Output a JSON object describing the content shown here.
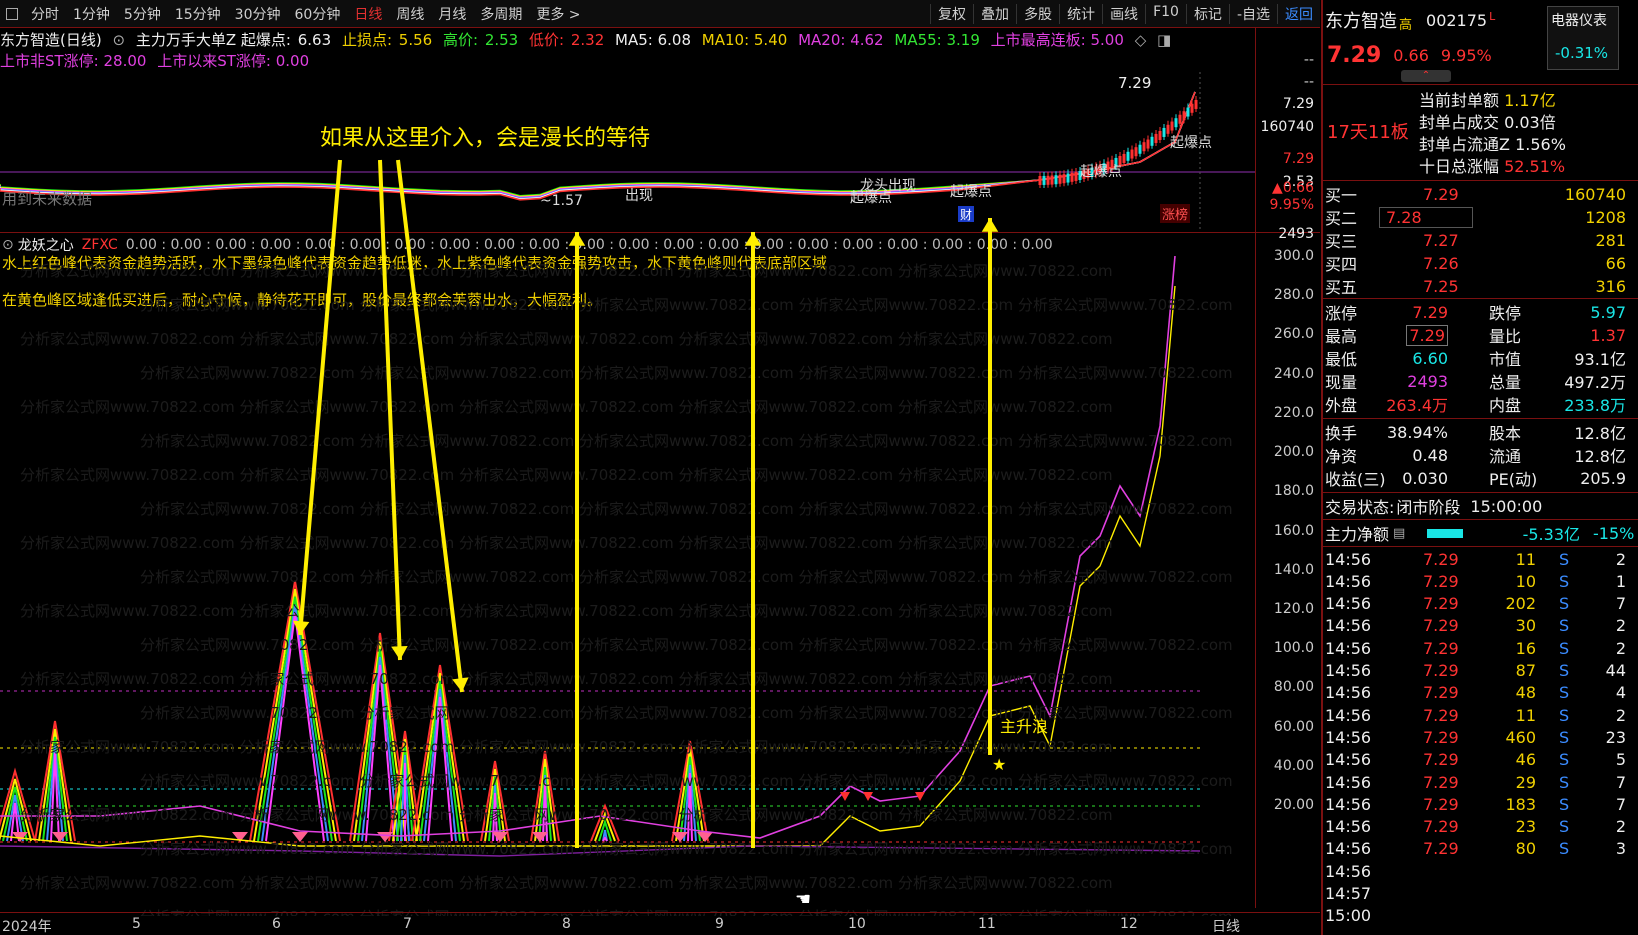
{
  "toolbar": {
    "periods": [
      "分时",
      "1分钟",
      "5分钟",
      "15分钟",
      "30分钟",
      "60分钟",
      "日线",
      "周线",
      "月线",
      "多周期",
      "更多 >"
    ],
    "active_period": "日线",
    "tools": [
      "复权",
      "叠加",
      "多股",
      "统计",
      "画线",
      "F10",
      "标记",
      "-自选",
      "返回"
    ]
  },
  "header": {
    "title": "东方智造(日线)",
    "indicator": "主力万手大单Z 起爆点:",
    "qibao": "6.63",
    "stoploss_label": "止损点:",
    "stoploss": "5.56",
    "high_label": "高价:",
    "high": "2.53",
    "low_label": "低价:",
    "low": "2.32",
    "ma5": "MA5: 6.08",
    "ma10": "MA10: 5.40",
    "ma20": "MA20: 4.62",
    "ma55": "MA55: 3.19",
    "max_board": "上市最高连板: 5.00",
    "line2_a": "上市非ST涨停: 28.00",
    "line2_b": "上市以来ST涨停: 0.00"
  },
  "main_chart": {
    "future_note": "用到未来数据",
    "labels": [
      "~1.57",
      "出现",
      "龙头出现",
      "起爆点",
      "起爆点",
      "起爆点",
      "起爆点"
    ],
    "price_top": "7.29",
    "cai": "财"
  },
  "annotation": "如果从这里介入，会是漫长的等待",
  "indicator_line": {
    "name": "龙妖之心",
    "code": "ZFXC",
    "values": "0.00 : 0.00 : 0.00 : 0.00 : 0.00 : 0.00 : 0.00 : 0.00 : 0.00 : 0.00 : 0.00 : 0.00 : 0.00 : 0.00 : 0.00 : 0.00 : 0.00 : 0.00 : 0.00 : 0.00 : 0.00"
  },
  "explain": {
    "line1": "水上红色峰代表资金趋势活跃，水下墨绿色峰代表资金趋势低迷，水上紫色峰代表资金强势攻击，水下黄色峰则代表底部区域",
    "line2": "在黄色峰区域逢低买进后，耐心守候，静待花开即可，股价最终都会芙蓉出水，大幅盈利。"
  },
  "lower_chart": {
    "label_wave": "主升浪"
  },
  "right_axis": {
    "top_labels": [
      "--",
      "--",
      "7.29",
      "160740",
      "7.29",
      "2.53",
      "▲0.66",
      "9.95%",
      "涨榜"
    ],
    "lower_label": "2493",
    "ticks": [
      "300.0",
      "280.0",
      "260.0",
      "240.0",
      "220.0",
      "200.0",
      "180.0",
      "160.0",
      "140.0",
      "120.0",
      "100.0",
      "80.00",
      "60.00",
      "40.00",
      "20.00"
    ]
  },
  "bottom_axis": {
    "labels": [
      "2024年",
      "5",
      "6",
      "7",
      "8",
      "9",
      "10",
      "11",
      "12"
    ],
    "period": "日线"
  },
  "quote": {
    "name": "东方智造",
    "mark": "高",
    "code": "002175",
    "L": "L",
    "sector": "电器仪表",
    "sector_pct": "-0.31%",
    "price": "7.29",
    "change": "0.66",
    "pct": "9.95%",
    "boards": "17天11板",
    "seal_label": "当前封单额",
    "seal_value": "1.17亿",
    "seal_turn_label": "封单占成交",
    "seal_turn": "0.03倍",
    "seal_float_label": "封单占流通Z",
    "seal_float": "1.56%",
    "ten_day_label": "十日总涨幅",
    "ten_day": "52.51%",
    "bids": [
      {
        "label": "买一",
        "price": "7.29",
        "vol": "160740"
      },
      {
        "label": "买二",
        "price": "7.28",
        "vol": "1208"
      },
      {
        "label": "买三",
        "price": "7.27",
        "vol": "281"
      },
      {
        "label": "买四",
        "price": "7.26",
        "vol": "66"
      },
      {
        "label": "买五",
        "price": "7.25",
        "vol": "316"
      }
    ],
    "stats": [
      {
        "l1": "涨停",
        "v1": "7.29",
        "c1": "red",
        "l2": "跌停",
        "v2": "5.97",
        "c2": "green"
      },
      {
        "l1": "最高",
        "v1": "7.29",
        "c1": "red",
        "l2": "量比",
        "v2": "1.37",
        "c2": "red"
      },
      {
        "l1": "最低",
        "v1": "6.60",
        "c1": "green",
        "l2": "市值",
        "v2": "93.1亿",
        "c2": "white"
      },
      {
        "l1": "现量",
        "v1": "2493",
        "c1": "mag",
        "l2": "总量",
        "v2": "497.2万",
        "c2": "white"
      },
      {
        "l1": "外盘",
        "v1": "263.4万",
        "c1": "red",
        "l2": "内盘",
        "v2": "233.8万",
        "c2": "green"
      }
    ],
    "fund": [
      {
        "l1": "换手",
        "v1": "38.94%",
        "l2": "股本",
        "v2": "12.8亿"
      },
      {
        "l1": "净资",
        "v1": "0.48",
        "l2": "流通",
        "v2": "12.8亿"
      },
      {
        "l1": "收益(三)",
        "v1": "0.030",
        "l2": "PE(动)",
        "v2": "205.9"
      }
    ],
    "trade_state_label": "交易状态:",
    "trade_state": "闭市阶段",
    "trade_time": "15:00:00",
    "main_net_label": "主力净额",
    "main_net": "-5.33亿",
    "main_net_pct": "-15%",
    "ticks": [
      {
        "t": "14:56",
        "p": "7.29",
        "v": "11",
        "s": "S",
        "n": "2"
      },
      {
        "t": "14:56",
        "p": "7.29",
        "v": "10",
        "s": "S",
        "n": "1"
      },
      {
        "t": "14:56",
        "p": "7.29",
        "v": "202",
        "s": "S",
        "n": "7"
      },
      {
        "t": "14:56",
        "p": "7.29",
        "v": "30",
        "s": "S",
        "n": "2"
      },
      {
        "t": "14:56",
        "p": "7.29",
        "v": "16",
        "s": "S",
        "n": "2"
      },
      {
        "t": "14:56",
        "p": "7.29",
        "v": "87",
        "s": "S",
        "n": "44"
      },
      {
        "t": "14:56",
        "p": "7.29",
        "v": "48",
        "s": "S",
        "n": "4"
      },
      {
        "t": "14:56",
        "p": "7.29",
        "v": "11",
        "s": "S",
        "n": "2"
      },
      {
        "t": "14:56",
        "p": "7.29",
        "v": "460",
        "s": "S",
        "n": "23"
      },
      {
        "t": "14:56",
        "p": "7.29",
        "v": "46",
        "s": "S",
        "n": "5"
      },
      {
        "t": "14:56",
        "p": "7.29",
        "v": "29",
        "s": "S",
        "n": "7"
      },
      {
        "t": "14:56",
        "p": "7.29",
        "v": "183",
        "s": "S",
        "n": "7"
      },
      {
        "t": "14:56",
        "p": "7.29",
        "v": "23",
        "s": "S",
        "n": "2"
      },
      {
        "t": "14:56",
        "p": "7.29",
        "v": "80",
        "s": "S",
        "n": "3"
      },
      {
        "t": "14:56",
        "p": "",
        "v": "",
        "s": "",
        "n": ""
      },
      {
        "t": "14:57",
        "p": "",
        "v": "",
        "s": "",
        "n": ""
      },
      {
        "t": "15:00",
        "p": "",
        "v": "",
        "s": "",
        "n": ""
      }
    ]
  },
  "watermark_site": "分析家公式网",
  "watermark_url": "www.70822.com"
}
